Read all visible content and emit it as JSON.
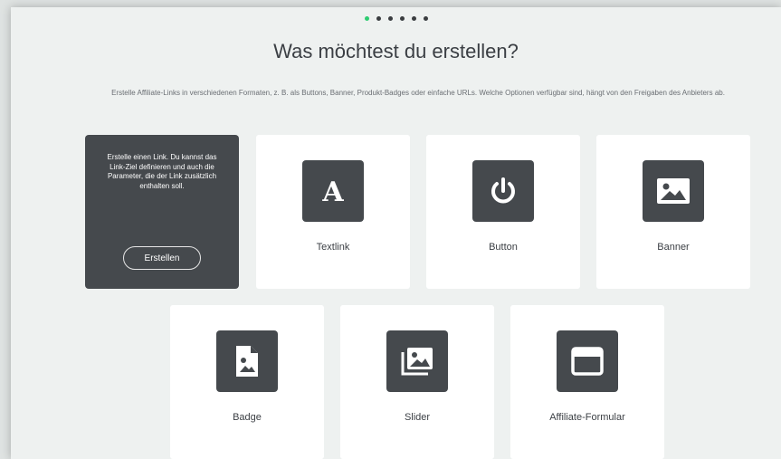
{
  "header": {
    "title": "Was möchtest du erstellen?",
    "description": "Erstelle Affiliate-Links in verschiedenen Formaten, z. B. als Buttons, Banner, Produkt-Badges oder einfache URLs. Welche Optionen verfügbar sind, hängt von den Freigaben des Anbieters ab."
  },
  "pagination": {
    "total_steps": 6,
    "active_step": 1,
    "active_color": "#2ecc71"
  },
  "intro_card": {
    "text": "Erstelle einen Link. Du kannst das Link-Ziel definieren und auch die Parameter, die der Link zusätzlich enthalten soll.",
    "button_label": "Erstellen"
  },
  "options": [
    {
      "label": "Textlink",
      "icon": "letter-a-icon"
    },
    {
      "label": "Button",
      "icon": "power-icon"
    },
    {
      "label": "Banner",
      "icon": "image-icon"
    },
    {
      "label": "Badge",
      "icon": "document-image-icon"
    },
    {
      "label": "Slider",
      "icon": "image-gallery-icon"
    },
    {
      "label": "Affiliate-Formular",
      "icon": "window-icon"
    }
  ],
  "colors": {
    "card_dark": "#45494d",
    "background": "#eef1f0"
  }
}
